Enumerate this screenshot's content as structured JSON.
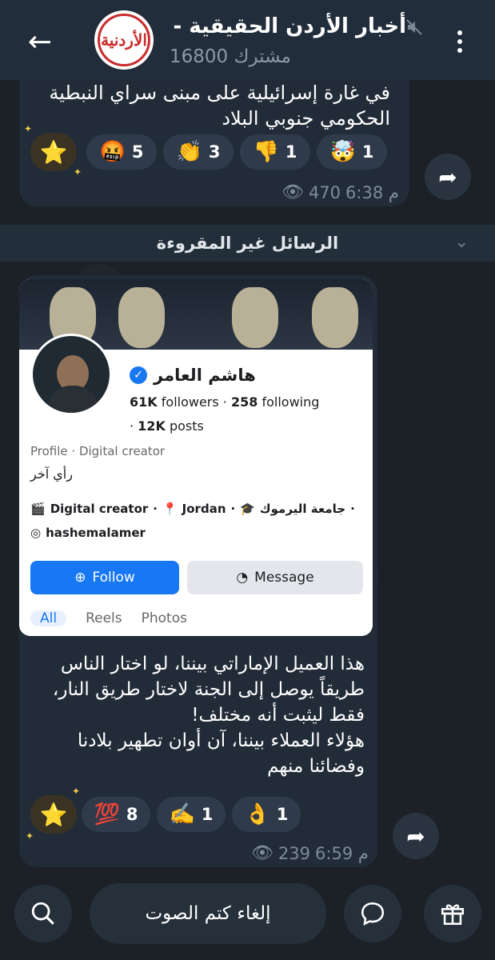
{
  "header": {
    "title": "أخبار الأردن الحقيقية -",
    "subscribers": "16800 مشترك",
    "avatar_logo": "الأردنية"
  },
  "message1": {
    "text_line1": "في غارة إسرائيلية على مبنى سراي النبطية",
    "text_line2": "الحكومي جنوبي البلاد",
    "reactions": [
      {
        "emoji": "🤯",
        "count": "1"
      },
      {
        "emoji": "👎",
        "count": "1"
      },
      {
        "emoji": "👏",
        "count": "3"
      },
      {
        "emoji": "🤬",
        "count": "5"
      }
    ],
    "star_emoji": "⭐",
    "views": "470",
    "time": "6:38 م"
  },
  "unread_divider": "الرسائل غير المقروءة",
  "message2": {
    "profile": {
      "name": "هاشم العامر",
      "followers": "61K",
      "followers_label": "followers",
      "following": "258",
      "following_label": "following",
      "posts": "12K",
      "posts_label": "posts",
      "profile_type": "Profile · Digital creator",
      "bio": "رأي آخر",
      "info_creator": "Digital creator",
      "info_location": "Jordan",
      "info_school": "جامعة اليرموك",
      "instagram": "hashemalamer",
      "follow_label": "Follow",
      "message_label": "Message",
      "tabs": [
        "All",
        "Reels",
        "Photos"
      ]
    },
    "text_lines": [
      "هذا العميل الإماراتي بيننا، لو اختار الناس",
      "طريقاً يوصل إلى الجنة لاختار طريق النار،",
      "فقط ليثبت أنه مختلف!",
      "هؤلاء العملاء بيننا، آن أوان تطهير بلادنا",
      "وفضائنا منهم"
    ],
    "reactions": [
      {
        "emoji": "👌",
        "count": "1"
      },
      {
        "emoji": "✍️",
        "count": "1"
      },
      {
        "emoji": "💯",
        "count": "8"
      }
    ],
    "star_emoji": "⭐",
    "views": "239",
    "time": "6:59 م"
  },
  "bottom": {
    "unmute_label": "إلغاء كتم الصوت"
  },
  "colors": {
    "header_bg": "#212d3b",
    "bubble_bg": "#222c38",
    "accent_blue": "#1877f2"
  }
}
